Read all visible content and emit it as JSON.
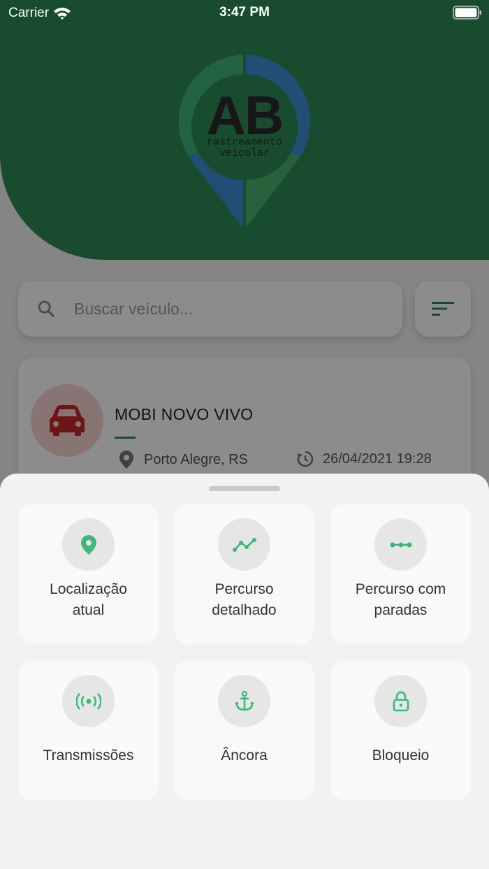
{
  "status_bar": {
    "carrier": "Carrier",
    "time": "3:47 PM"
  },
  "logo": {
    "main": "AB",
    "line1": "rastreamento",
    "line2": "veicular"
  },
  "search": {
    "placeholder": "Buscar veículo..."
  },
  "vehicle": {
    "name": "MOBI NOVO VIVO",
    "location": "Porto Alegre, RS",
    "datetime": "26/04/2021 19:28"
  },
  "actions": [
    {
      "label": "Localização\natual",
      "icon": "map-pin-icon"
    },
    {
      "label": "Percurso\ndetalhado",
      "icon": "route-icon"
    },
    {
      "label": "Percurso com\nparadas",
      "icon": "stops-icon"
    },
    {
      "label": "Transmissões",
      "icon": "broadcast-icon"
    },
    {
      "label": "Âncora",
      "icon": "anchor-icon"
    },
    {
      "label": "Bloqueio",
      "icon": "lock-icon"
    }
  ],
  "colors": {
    "brand_green": "#2e8b57",
    "icon_green": "#3cb878",
    "vehicle_red": "#c62828"
  }
}
